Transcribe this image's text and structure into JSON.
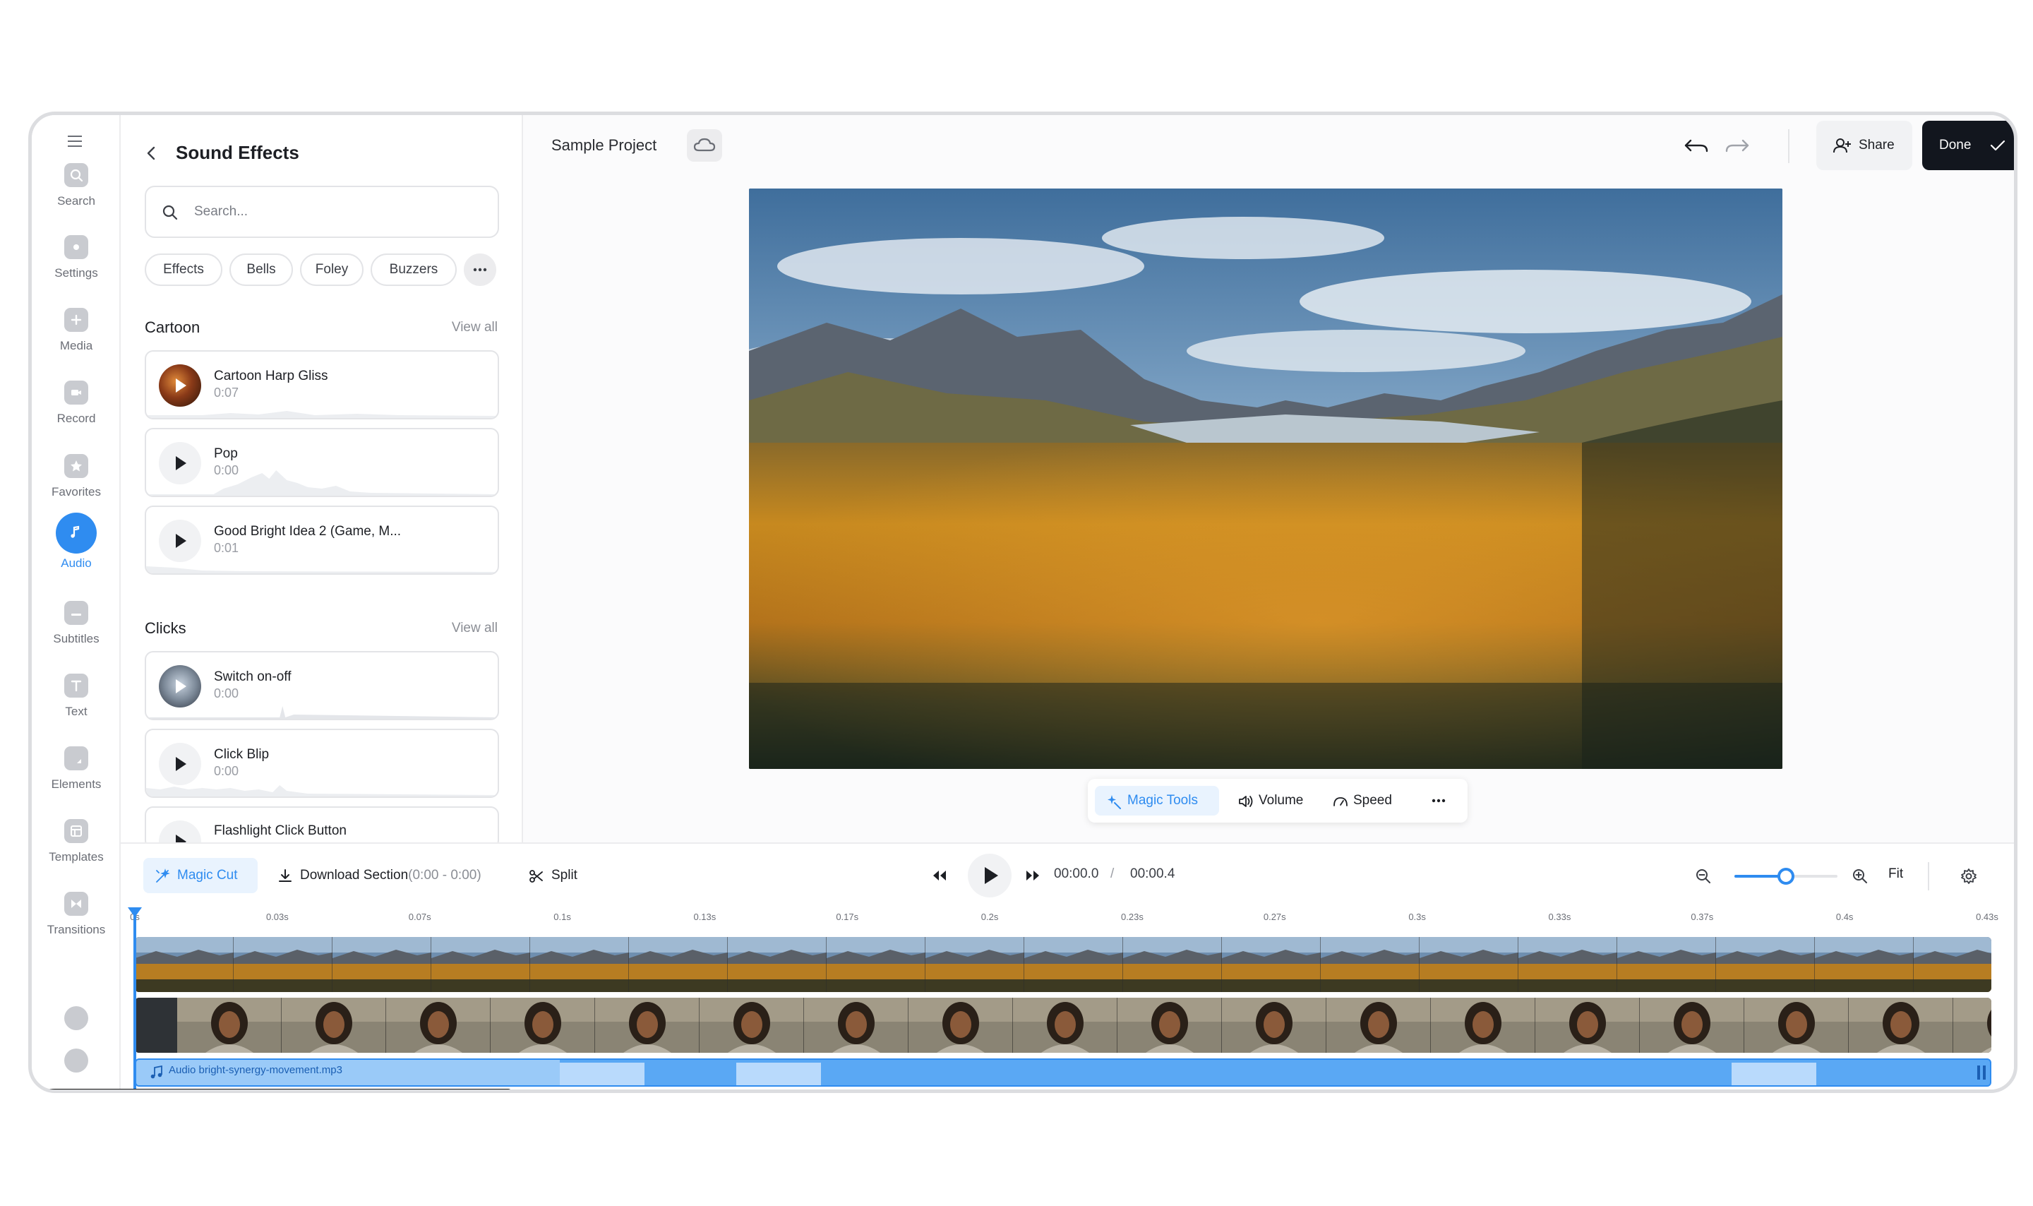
{
  "rail": {
    "items": [
      {
        "id": "search",
        "label": "Search",
        "icon": "search-icon"
      },
      {
        "id": "settings",
        "label": "Settings",
        "icon": "gear-icon"
      },
      {
        "id": "media",
        "label": "Media",
        "icon": "plus-icon"
      },
      {
        "id": "record",
        "label": "Record",
        "icon": "camera-icon"
      },
      {
        "id": "favorites",
        "label": "Favorites",
        "icon": "star-icon"
      },
      {
        "id": "audio",
        "label": "Audio",
        "icon": "music-note-icon",
        "active": true
      },
      {
        "id": "subtitles",
        "label": "Subtitles",
        "icon": "subtitles-icon"
      },
      {
        "id": "text",
        "label": "Text",
        "icon": "text-icon"
      },
      {
        "id": "elements",
        "label": "Elements",
        "icon": "shapes-icon"
      },
      {
        "id": "templates",
        "label": "Templates",
        "icon": "templates-icon"
      },
      {
        "id": "transitions",
        "label": "Transitions",
        "icon": "transitions-icon"
      }
    ]
  },
  "panel": {
    "title": "Sound Effects",
    "search_placeholder": "Search...",
    "chips": [
      "Effects",
      "Bells",
      "Foley",
      "Buzzers"
    ],
    "sections": [
      {
        "title": "Cartoon",
        "view_all": "View all",
        "items": [
          {
            "name": "Cartoon Harp Gliss",
            "duration": "0:07"
          },
          {
            "name": "Pop",
            "duration": "0:00"
          },
          {
            "name": "Good Bright Idea 2 (Game, M...",
            "duration": "0:01"
          }
        ]
      },
      {
        "title": "Clicks",
        "view_all": "View all",
        "items": [
          {
            "name": "Switch on-off",
            "duration": "0:00"
          },
          {
            "name": "Click Blip",
            "duration": "0:00"
          },
          {
            "name": "Flashlight Click Button",
            "duration": ""
          }
        ]
      }
    ]
  },
  "header": {
    "project_name": "Sample Project",
    "share_label": "Share",
    "done_label": "Done"
  },
  "toolbar": {
    "magic_tools": "Magic Tools",
    "volume": "Volume",
    "speed": "Speed"
  },
  "timeline": {
    "magic_cut": "Magic Cut",
    "download_section": "Download Section",
    "download_range": "(0:00 - 0:00)",
    "split": "Split",
    "current_time": "00:00.0",
    "separator": "/",
    "total_time": "00:00.4",
    "fit": "Fit",
    "zoom_level": 0.5,
    "ticks": [
      "0s",
      "0.03s",
      "0.07s",
      "0.1s",
      "0.13s",
      "0.17s",
      "0.2s",
      "0.23s",
      "0.27s",
      "0.3s",
      "0.33s",
      "0.37s",
      "0.4s",
      "0.43s"
    ],
    "audio_clip": "Audio bright-synergy-movement.mp3"
  },
  "colors": {
    "accent": "#2f8cf0",
    "done_bg": "#12161e"
  }
}
